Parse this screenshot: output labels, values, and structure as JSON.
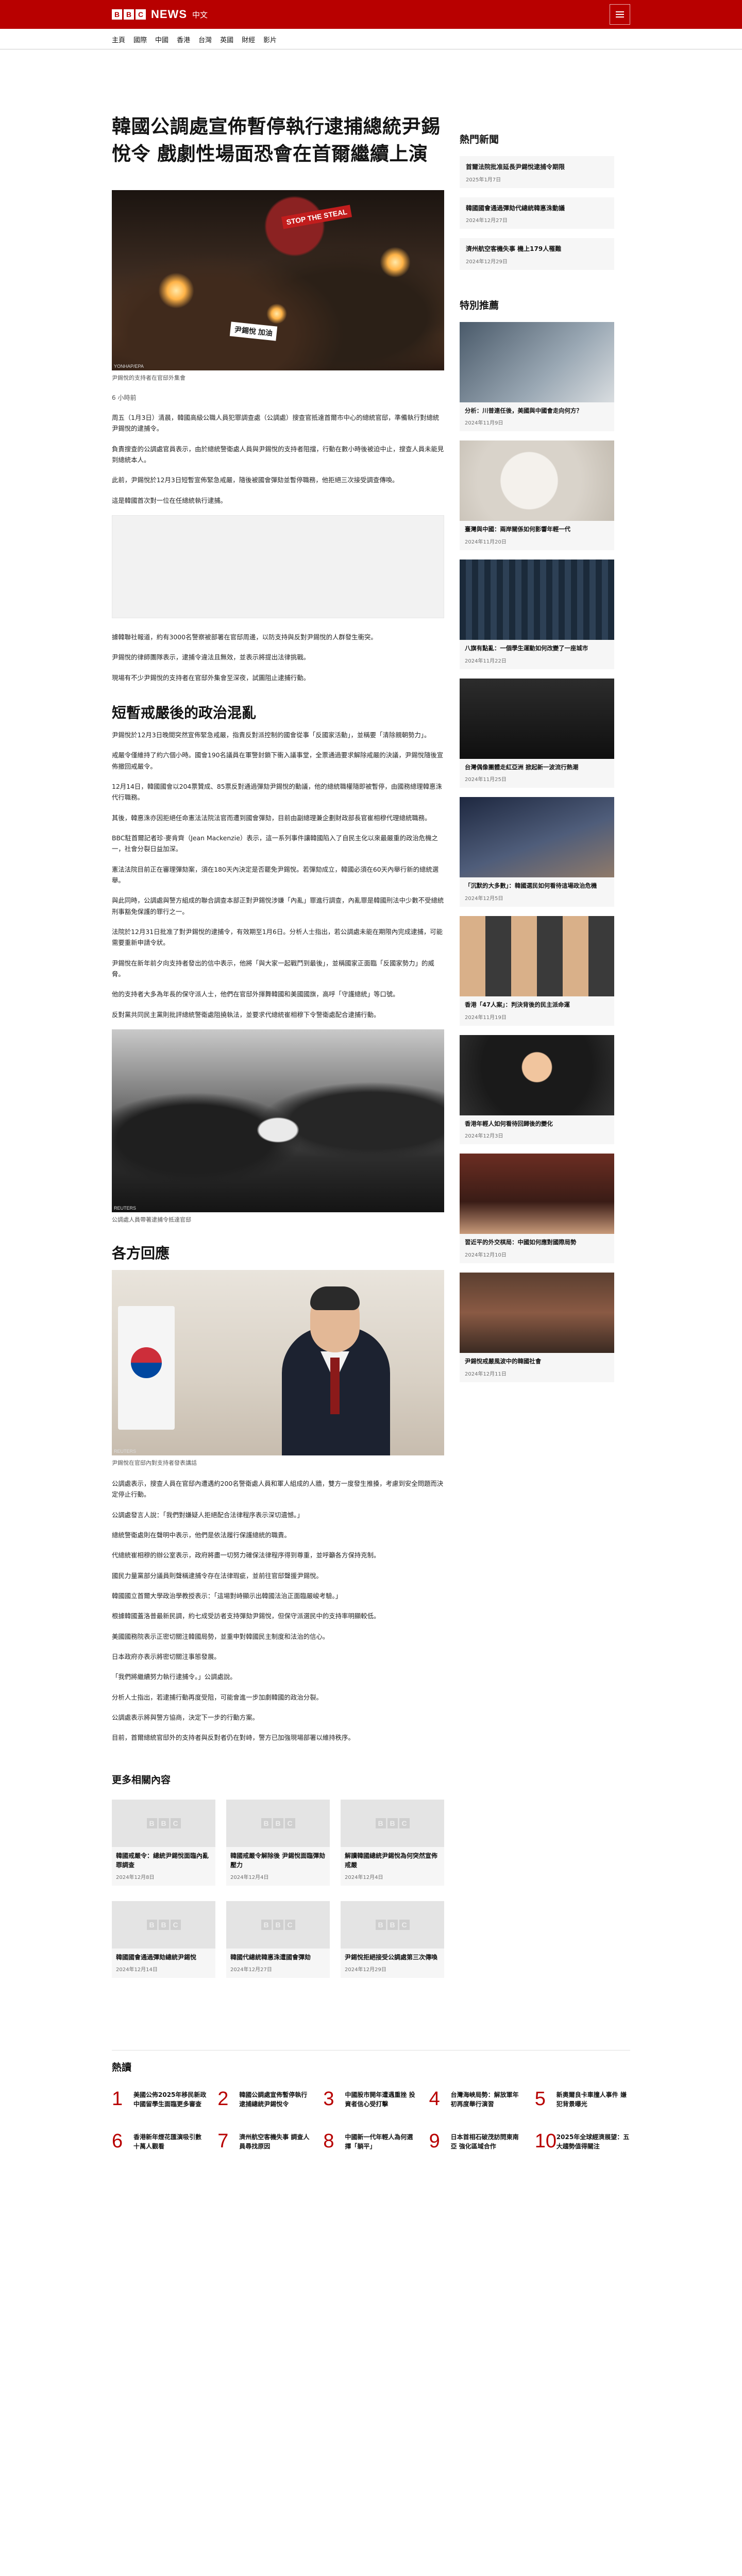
{
  "header": {
    "brand_letters": [
      "B",
      "B",
      "C"
    ],
    "brand_name": "NEWS",
    "brand_lang": "中文",
    "menu_icon": "hamburger-menu-icon"
  },
  "nav": [
    "主頁",
    "國際",
    "中國",
    "香港",
    "台灣",
    "英國",
    "財經",
    "影片"
  ],
  "article": {
    "headline": "韓國公調處宣佈暫停執行逮捕總統尹錫悅令 戲劇性場面恐會在首爾繼續上演",
    "hero_credit": "YONHAP/EPA",
    "hero_caption": "尹錫悅的支持者在官邸外集會",
    "hero_sign_1": "STOP THE STEAL",
    "hero_sign_2": "尹錫悅 加油",
    "byline": "6 小時前",
    "paragraphs_1": [
      "周五（1月3日）清晨，韓國高級公職人員犯罪調查處（公調處）搜查官抵達首爾市中心的總統官邸，準備執行對總統尹錫悅的逮捕令。",
      "負責搜查的公調處官員表示，由於總統警衛處人員與尹錫悅的支持者阻擋，行動在數小時後被迫中止，搜查人員未能見到總統本人。",
      "此前，尹錫悅於12月3日短暫宣佈緊急戒嚴，隨後被國會彈劾並暫停職務，他拒絕三次接受調查傳喚。",
      "這是韓國首次對一位在任總統執行逮捕。"
    ],
    "paragraphs_2": [
      "據韓聯社報道，約有3000名警察被部署在官邸周邊，以防支持與反對尹錫悅的人群發生衝突。",
      "尹錫悅的律師團隊表示，逮捕令違法且無效，並表示將提出法律挑戰。",
      "現場有不少尹錫悅的支持者在官邸外集會至深夜，試圖阻止逮捕行動。"
    ],
    "subhead_1": "短暫戒嚴後的政治混亂",
    "paragraphs_3": [
      "尹錫悅於12月3日晚間突然宣佈緊急戒嚴，指責反對派控制的國會從事「反國家活動」，並稱要「清除親朝勢力」。",
      "戒嚴令僅維持了約六個小時。國會190名議員在軍警封鎖下衝入議事堂，全票通過要求解除戒嚴的決議，尹錫悅隨後宣佈撤回戒嚴令。",
      "12月14日，韓國國會以204票贊成、85票反對通過彈劾尹錫悅的動議，他的總統職權隨即被暫停，由國務總理韓悳洙代行職務。",
      "其後，韓悳洙亦因拒絕任命憲法法院法官而遭到國會彈劾，目前由副總理兼企劃財政部長官崔相穆代理總統職務。",
      "BBC駐首爾記者珍·麥肯齊（Jean Mackenzie）表示，這一系列事件讓韓國陷入了自民主化以來最嚴重的政治危機之一，社會分裂日益加深。",
      "憲法法院目前正在審理彈劾案，須在180天內決定是否罷免尹錫悅。若彈劾成立，韓國必須在60天內舉行新的總統選舉。",
      "與此同時，公調處與警方組成的聯合調查本部正對尹錫悅涉嫌「內亂」罪進行調查，內亂罪是韓國刑法中少數不受總統刑事豁免保護的罪行之一。",
      "法院於12月31日批准了對尹錫悅的逮捕令，有效期至1月6日。分析人士指出，若公調處未能在期限內完成逮捕，可能需要重新申請令狀。",
      "尹錫悅在新年前夕向支持者發出的信中表示，他將「與大家一起戰鬥到最後」，並稱國家正面臨「反國家勢力」的威脅。",
      "他的支持者大多為年長的保守派人士，他們在官邸外揮舞韓國和美國國旗，高呼「守護總統」等口號。",
      "反對黨共同民主黨則批評總統警衛處阻撓執法，並要求代總統崔相穆下令警衛處配合逮捕行動。"
    ],
    "crowd_credit": "REUTERS",
    "crowd_caption": "公調處人員帶著逮捕令抵達官邸",
    "subhead_2": "各方回應",
    "yoon_credit": "REUTERS",
    "yoon_caption": "尹錫悅在官邸內對支持者發表講話",
    "paragraphs_4": [
      "公調處表示，搜查人員在官邸內遭遇約200名警衛處人員和軍人組成的人牆，雙方一度發生推搡，考慮到安全問題而決定停止行動。",
      "公調處發言人說：「我們對嫌疑人拒絕配合法律程序表示深切遺憾。」",
      "總統警衛處則在聲明中表示，他們是依法履行保護總統的職責。",
      "代總統崔相穆的辦公室表示，政府將盡一切努力確保法律程序得到尊重，並呼籲各方保持克制。",
      "國民力量黨部分議員則聲稱逮捕令存在法律瑕疵，並前往官邸聲援尹錫悅。",
      "韓國國立首爾大學政治學教授表示：「這場對峙顯示出韓國法治正面臨嚴峻考驗。」",
      "根據韓國蓋洛普最新民調，約七成受訪者支持彈劾尹錫悅，但保守派選民中的支持率明顯較低。",
      "美國國務院表示正密切關注韓國局勢，並重申對韓國民主制度和法治的信心。",
      "日本政府亦表示將密切關注事態發展。",
      "「我們將繼續努力執行逮捕令。」公調處說。",
      "分析人士指出，若逮捕行動再度受阻，可能會進一步加劇韓國的政治分裂。",
      "公調處表示將與警方協商，決定下一步的行動方案。",
      "目前，首爾總統官邸外的支持者與反對者仍在對峙，警方已加強現場部署以維持秩序。"
    ]
  },
  "sidebar": {
    "latest_title": "熱門新聞",
    "latest": [
      {
        "title": "首爾法院批准延長尹錫悅逮捕令期限",
        "date": "2025年1月7日"
      },
      {
        "title": "韓國國會通過彈劾代總統韓悳洙動議",
        "date": "2024年12月27日"
      },
      {
        "title": "濟州航空客機失事 機上179人罹難",
        "date": "2024年12月29日"
      }
    ],
    "featured_title": "特別推薦",
    "featured": [
      {
        "title": "分析：川普連任後，美國與中國會走向何方？",
        "date": "2024年11月9日"
      },
      {
        "title": "臺灣與中國：兩岸關係如何影響年輕一代",
        "date": "2024年11月20日"
      },
      {
        "title": "八旗有點亂：一個學生運動如何改變了一座城市",
        "date": "2024年11月22日"
      },
      {
        "title": "台灣偶像團體走紅亞洲 掀起新一波流行熱潮",
        "date": "2024年11月25日"
      },
      {
        "title": "「沉默的大多數」：韓國選民如何看待這場政治危機",
        "date": "2024年12月5日"
      },
      {
        "title": "香港「47人案」：判決背後的民主派命運",
        "date": "2024年11月19日"
      },
      {
        "title": "香港年輕人如何看待回歸後的變化",
        "date": "2024年12月3日"
      },
      {
        "title": "習近平的外交棋局：中國如何應對國際局勢",
        "date": "2024年12月10日"
      },
      {
        "title": "尹錫悅戒嚴風波中的韓國社會",
        "date": "2024年12月11日"
      }
    ]
  },
  "related": {
    "title": "更多相關內容",
    "items": [
      {
        "title": "韓國戒嚴令：總統尹錫悅面臨內亂罪調查",
        "date": "2024年12月8日"
      },
      {
        "title": "韓國戒嚴令解除後 尹錫悅面臨彈劾壓力",
        "date": "2024年12月4日"
      },
      {
        "title": "解讀韓國總統尹錫悅為何突然宣佈戒嚴",
        "date": "2024年12月4日"
      },
      {
        "title": "韓國國會通過彈劾總統尹錫悅",
        "date": "2024年12月14日"
      },
      {
        "title": "韓國代總統韓悳洙遭國會彈劾",
        "date": "2024年12月27日"
      },
      {
        "title": "尹錫悅拒絕接受公調處第三次傳喚",
        "date": "2024年12月29日"
      }
    ]
  },
  "popular": {
    "title": "熱讀",
    "items": [
      {
        "num": "1",
        "title": "美國公佈2025年移民新政 中國留學生面臨更多審查"
      },
      {
        "num": "2",
        "title": "韓國公調處宣佈暫停執行逮捕總統尹錫悅令"
      },
      {
        "num": "3",
        "title": "中國股市開年遭遇重挫 投資者信心受打擊"
      },
      {
        "num": "4",
        "title": "台灣海峽局勢：解放軍年初再度舉行演習"
      },
      {
        "num": "5",
        "title": "新奧爾良卡車撞人事件 嫌犯背景曝光"
      },
      {
        "num": "6",
        "title": "香港新年煙花匯演吸引數十萬人觀看"
      },
      {
        "num": "7",
        "title": "濟州航空客機失事 調查人員尋找原因"
      },
      {
        "num": "8",
        "title": "中國新一代年輕人為何選擇「躺平」"
      },
      {
        "num": "9",
        "title": "日本首相石破茂訪問東南亞 強化區域合作"
      },
      {
        "num": "10",
        "title": "2025年全球經濟展望：五大趨勢值得關注"
      }
    ]
  }
}
